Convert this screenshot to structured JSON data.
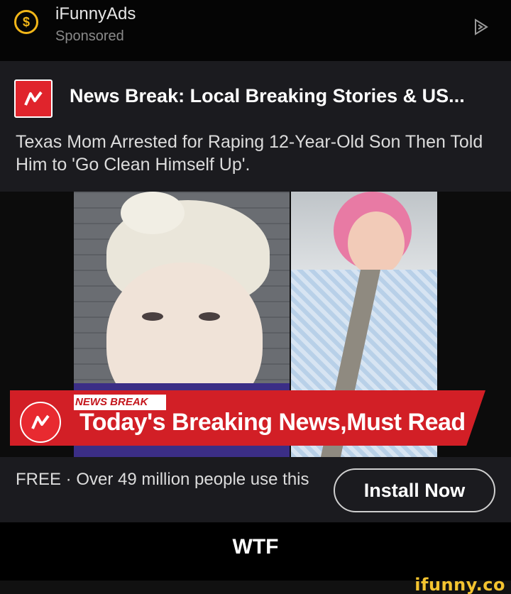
{
  "header": {
    "advertiser": "iFunnyAds",
    "sponsored": "Sponsored",
    "coin_symbol": "$",
    "adchoices_icon": "adchoices-play-icon",
    "accent": "#f2b619"
  },
  "card": {
    "app_title": "News Break: Local Breaking Stories & US...",
    "headline": "Texas Mom Arrested for Raping 12-Year-Old Son Then Told Him to 'Go Clean Himself Up'.",
    "media": {
      "banner_label": "NEWS BREAK",
      "banner_text": "Today's Breaking News,Must Read",
      "banner_color": "#d21f26"
    },
    "cta_text": "FREE · Over 49 million people use this",
    "install_label": "Install Now"
  },
  "caption": "WTF",
  "watermark": "ifunny.co"
}
